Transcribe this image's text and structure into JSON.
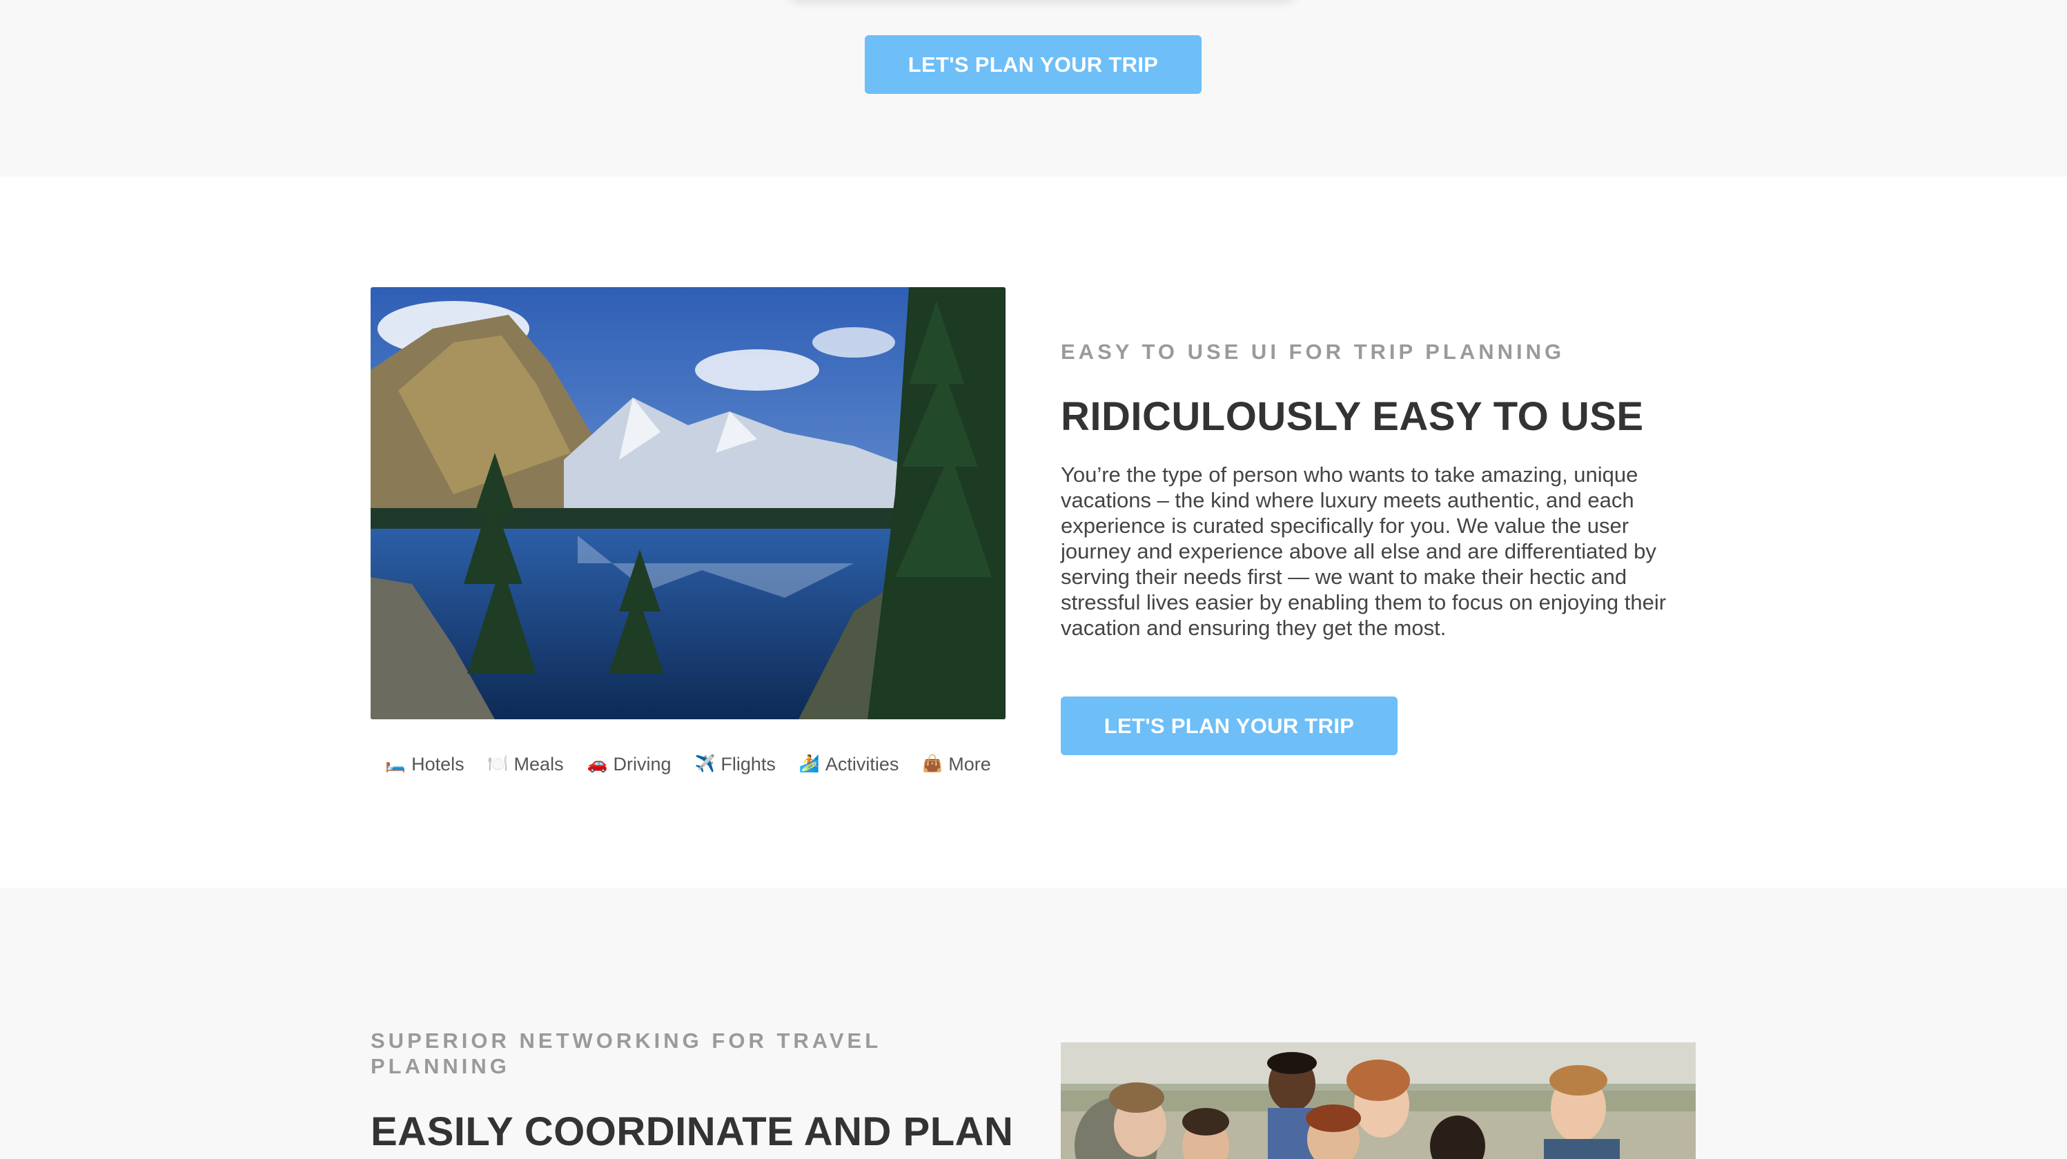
{
  "top_section": {
    "cta_label": "LET'S PLAN YOUR TRIP"
  },
  "feature_ui": {
    "eyebrow": "EASY TO USE UI FOR TRIP PLANNING",
    "heading": "RIDICULOUSLY EASY TO USE",
    "body": "You’re the type of person who wants to take amazing, unique vacations – the kind where luxury meets authentic, and each experience is curated specifically for you. We value the user journey and experience above all else and are differentiated by serving their needs first — we want to make their hectic and stressful lives easier by enabling them to focus on enjoying their vacation and ensuring they get the most.",
    "cta_label": "LET'S PLAN YOUR TRIP",
    "categories": [
      {
        "icon": "🛏️",
        "icon_name": "bed-icon",
        "label": "Hotels"
      },
      {
        "icon": "🍽️",
        "icon_name": "plate-icon",
        "label": "Meals"
      },
      {
        "icon": "🚗",
        "icon_name": "car-icon",
        "label": "Driving"
      },
      {
        "icon": "✈️",
        "icon_name": "airplane-icon",
        "label": "Flights"
      },
      {
        "icon": "🏄",
        "icon_name": "surfer-icon",
        "label": "Activities"
      },
      {
        "icon": "👜",
        "icon_name": "bag-icon",
        "label": "More"
      }
    ]
  },
  "feature_network": {
    "eyebrow": "SUPERIOR NETWORKING FOR TRAVEL PLANNING",
    "heading": "EASILY COORDINATE AND PLAN"
  },
  "colors": {
    "accent_button": "#6ebef7",
    "section_gray": "#f8f8f8",
    "eyebrow_gray": "#9a9a9a",
    "heading": "#333333"
  }
}
